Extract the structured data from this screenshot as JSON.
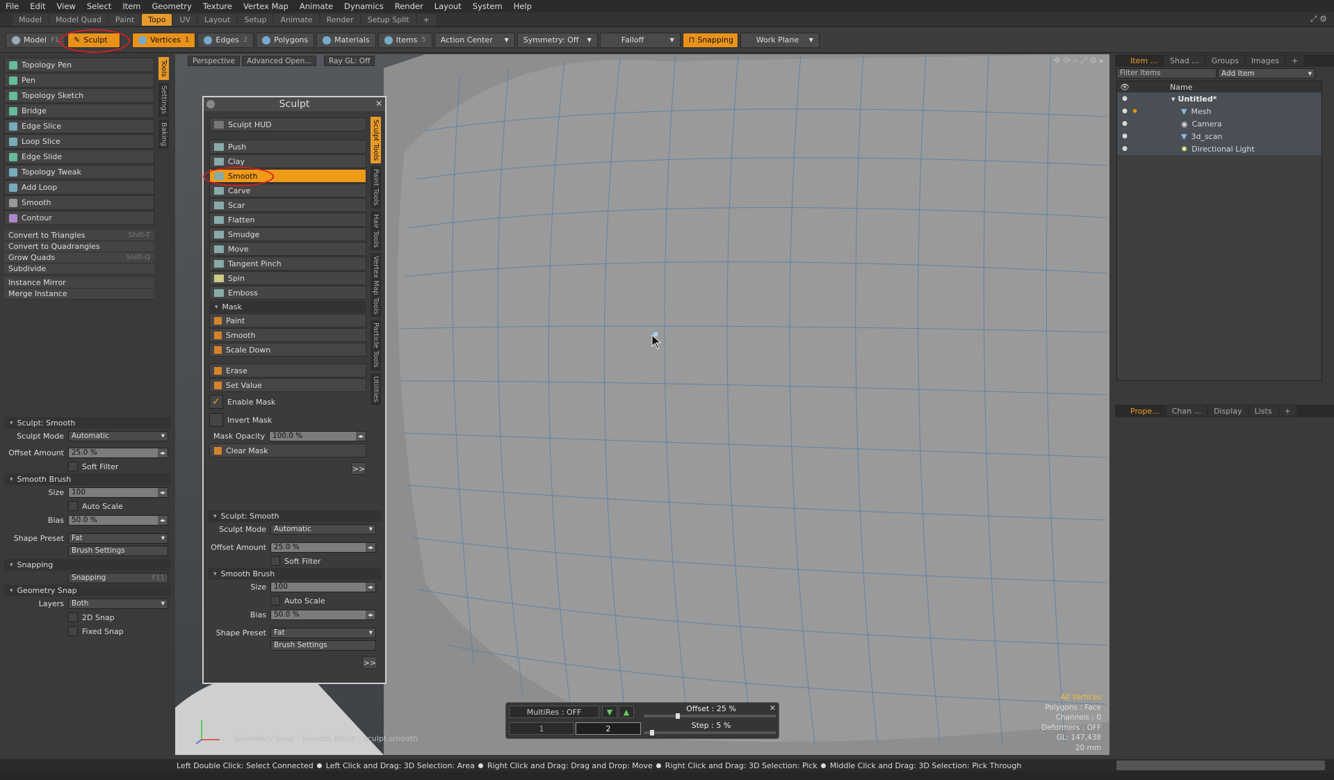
{
  "menubar": [
    "File",
    "Edit",
    "View",
    "Select",
    "Item",
    "Geometry",
    "Texture",
    "Vertex Map",
    "Animate",
    "Dynamics",
    "Render",
    "Layout",
    "System",
    "Help"
  ],
  "layout_tabs": [
    "Model",
    "Model Quad",
    "Paint",
    "Topo",
    "UV",
    "Layout",
    "Setup",
    "Animate",
    "Render",
    "Setup Split",
    "+"
  ],
  "toolbar": {
    "model": "Model",
    "model_key": "F1",
    "sculpt": "Sculpt",
    "vertices": "Vertices",
    "vertices_num": "1",
    "edges": "Edges",
    "edges_num": "2",
    "polygons": "Polygons",
    "materials": "Materials",
    "items": "Items",
    "items_num": "5",
    "action_center": "Action Center",
    "symmetry": "Symmetry: Off",
    "falloff": "Falloff",
    "snapping": "Snapping",
    "work_plane": "Work Plane"
  },
  "left_tools": [
    "Topology Pen",
    "Pen",
    "Topology Sketch",
    "Bridge",
    "Edge Slice",
    "Loop Slice",
    "Edge Slide",
    "Topology Tweak",
    "Add Loop",
    "Smooth",
    "Contour"
  ],
  "left_commands": [
    {
      "label": "Convert to Triangles",
      "shortcut": "Shift-T"
    },
    {
      "label": "Convert to Quadrangles",
      "shortcut": ""
    },
    {
      "label": "Grow Quads",
      "shortcut": "Shift-Q"
    },
    {
      "label": "Subdivide",
      "shortcut": ""
    }
  ],
  "left_commands2": [
    "Instance Mirror",
    "Merge Instance"
  ],
  "left_vtabs": [
    "Tools",
    "Settings",
    "Baking"
  ],
  "left_props": {
    "section_sculpt": "Sculpt: Smooth",
    "sculpt_mode_label": "Sculpt Mode",
    "sculpt_mode": "Automatic",
    "offset_label": "Offset Amount",
    "offset": "25.0 %",
    "soft_filter": "Soft Filter",
    "section_brush": "Smooth Brush",
    "size_label": "Size",
    "size": "100",
    "auto_scale": "Auto Scale",
    "bias_label": "Bias",
    "bias": "50.0 %",
    "shape_label": "Shape Preset",
    "shape": "Fat",
    "brush_settings": "Brush Settings",
    "section_snapping": "Snapping",
    "snapping_btn": "Snapping",
    "snapping_key": "F11",
    "section_geosnap": "Geometry Snap",
    "layers_label": "Layers",
    "layers": "Both",
    "snap2d": "2D Snap",
    "fixed_snap": "Fixed Snap"
  },
  "viewport": {
    "perspective": "Perspective",
    "advanced": "Advanced Open...",
    "raygl": "Ray GL: Off",
    "info_all": "All Vertices",
    "info_polygons": "Polygons : Face",
    "info_channels": "Channels : 0",
    "info_deformers": "Deformers : OFF",
    "info_gl": "GL: 147,438",
    "info_scale": "20 mm",
    "bottom_text": "Geometry Snap : Smooth Brush : sculpt.smooth"
  },
  "hud": {
    "multires": "MultiRes : OFF",
    "offset": "Offset : 25 %",
    "step": "Step : 5 %",
    "level1": "1",
    "level2": "2",
    "offset_level": 0.25,
    "step_level": 0.05
  },
  "sculpt_panel": {
    "title": "Sculpt",
    "hud_btn": "Sculpt HUD",
    "tools": [
      "Push",
      "Clay",
      "Smooth",
      "Carve",
      "Scar",
      "Flatten",
      "Smudge",
      "Move",
      "Tangent Pinch",
      "Spin",
      "Emboss"
    ],
    "mask_section": "Mask",
    "mask_tools": [
      "Paint",
      "Smooth",
      "Scale Down"
    ],
    "mask_tools2": [
      "Erase",
      "Set Value"
    ],
    "enable_mask": "Enable Mask",
    "invert_mask": "Invert Mask",
    "mask_opacity_label": "Mask Opacity",
    "mask_opacity": "100.0 %",
    "clear_mask": "Clear Mask",
    "more": ">>",
    "vtabs": [
      "Sculpt Tools",
      "Paint Tools",
      "Hair Tools",
      "Vertex Map Tools",
      "Particle Tools",
      "Utilities"
    ],
    "props": {
      "section_sculpt": "Sculpt: Smooth",
      "sculpt_mode_label": "Sculpt Mode",
      "sculpt_mode": "Automatic",
      "offset_label": "Offset Amount",
      "offset": "25.0 %",
      "soft_filter": "Soft Filter",
      "section_brush": "Smooth Brush",
      "size_label": "Size",
      "size": "100",
      "auto_scale": "Auto Scale",
      "bias_label": "Bias",
      "bias": "50.0 %",
      "shape_label": "Shape Preset",
      "shape": "Fat",
      "brush_settings": "Brush Settings"
    }
  },
  "right_top_tabs": [
    "Item ...",
    "Shad ...",
    "Groups",
    "Images",
    "+"
  ],
  "filter_items": "Filter Items",
  "add_item": "Add Item",
  "tree_header": "Name",
  "tree_items": [
    "Untitled*",
    "Mesh",
    "Camera",
    "3d_scan",
    "Directional Light"
  ],
  "right_bottom_tabs": [
    "Prope...",
    "Chan ...",
    "Display",
    "Lists",
    "+"
  ],
  "status": [
    "Left Double Click: Select Connected",
    "Left Click and Drag: 3D Selection: Area",
    "Right Click and Drag: Drag and Drop: Move",
    "Right Click and Drag: 3D Selection: Pick",
    "Middle Click and Drag: 3D Selection: Pick Through"
  ],
  "colors": {
    "accent": "#e89a2a",
    "highlight": "#f09a18",
    "circle": "#d42020",
    "info": "#f0c040"
  }
}
